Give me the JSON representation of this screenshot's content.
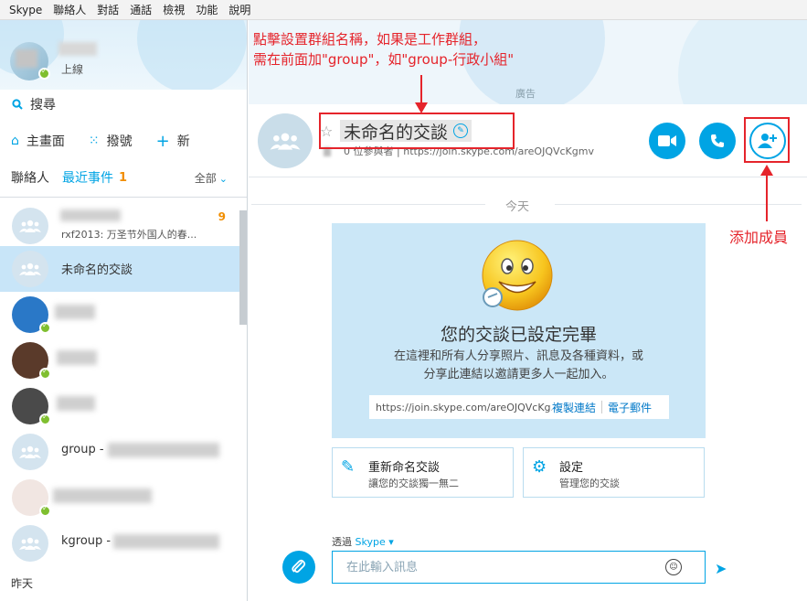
{
  "menubar": [
    "Skype",
    "聯絡人",
    "對話",
    "通話",
    "檢視",
    "功能",
    "說明"
  ],
  "profile": {
    "status": "上線"
  },
  "sidebar": {
    "search": "搜尋",
    "nav": {
      "home": "主畫面",
      "dialpad": "撥號",
      "new": "新"
    },
    "tabs": {
      "contacts": "聯絡人",
      "recent": "最近事件",
      "recent_count": "1",
      "filter": "全部"
    },
    "contacts": [
      {
        "name": "",
        "sub": "rxf2013: 万圣节外国人的春...",
        "badge": "9"
      },
      {
        "name": "未命名的交談"
      },
      {
        "name": ""
      },
      {
        "name": ""
      },
      {
        "name": ""
      },
      {
        "name": "group -"
      },
      {
        "name": ""
      },
      {
        "name": "kgroup -"
      }
    ],
    "yesterday": "昨天"
  },
  "banner": {
    "ad_label": "廣告"
  },
  "conversation": {
    "title": "未命名的交談",
    "participants": "0 位參與者",
    "url_sep": "|",
    "url": "https://join.skype.com/areOJQVcKgmv"
  },
  "timeline": {
    "today": "今天"
  },
  "welcome": {
    "title": "您的交談已設定完畢",
    "line1": "在這裡和所有人分享照片、訊息及各種資料，或",
    "line2": "分享此連結以邀請更多人一起加入。",
    "link": "https://join.skype.com/areOJQVcKg...",
    "copy_link": "複製連結",
    "email": "電子郵件"
  },
  "cards": {
    "rename": {
      "title": "重新命名交談",
      "sub": "讓您的交談獨一無二"
    },
    "settings": {
      "title": "設定",
      "sub": "管理您的交談"
    }
  },
  "composer": {
    "via": "透過",
    "via_service": "Skype",
    "placeholder": "在此輸入訊息"
  },
  "annotations": {
    "top_line1": "點擊設置群組名稱，如果是工作群組，",
    "top_line2": "需在前面加\"group\"，如\"group-行政小組\"",
    "add_member": "添加成員",
    "color": "#e5242b"
  },
  "colors": {
    "accent": "#00a4e4",
    "selected": "#c8e5f8",
    "badge": "#f18e00"
  }
}
